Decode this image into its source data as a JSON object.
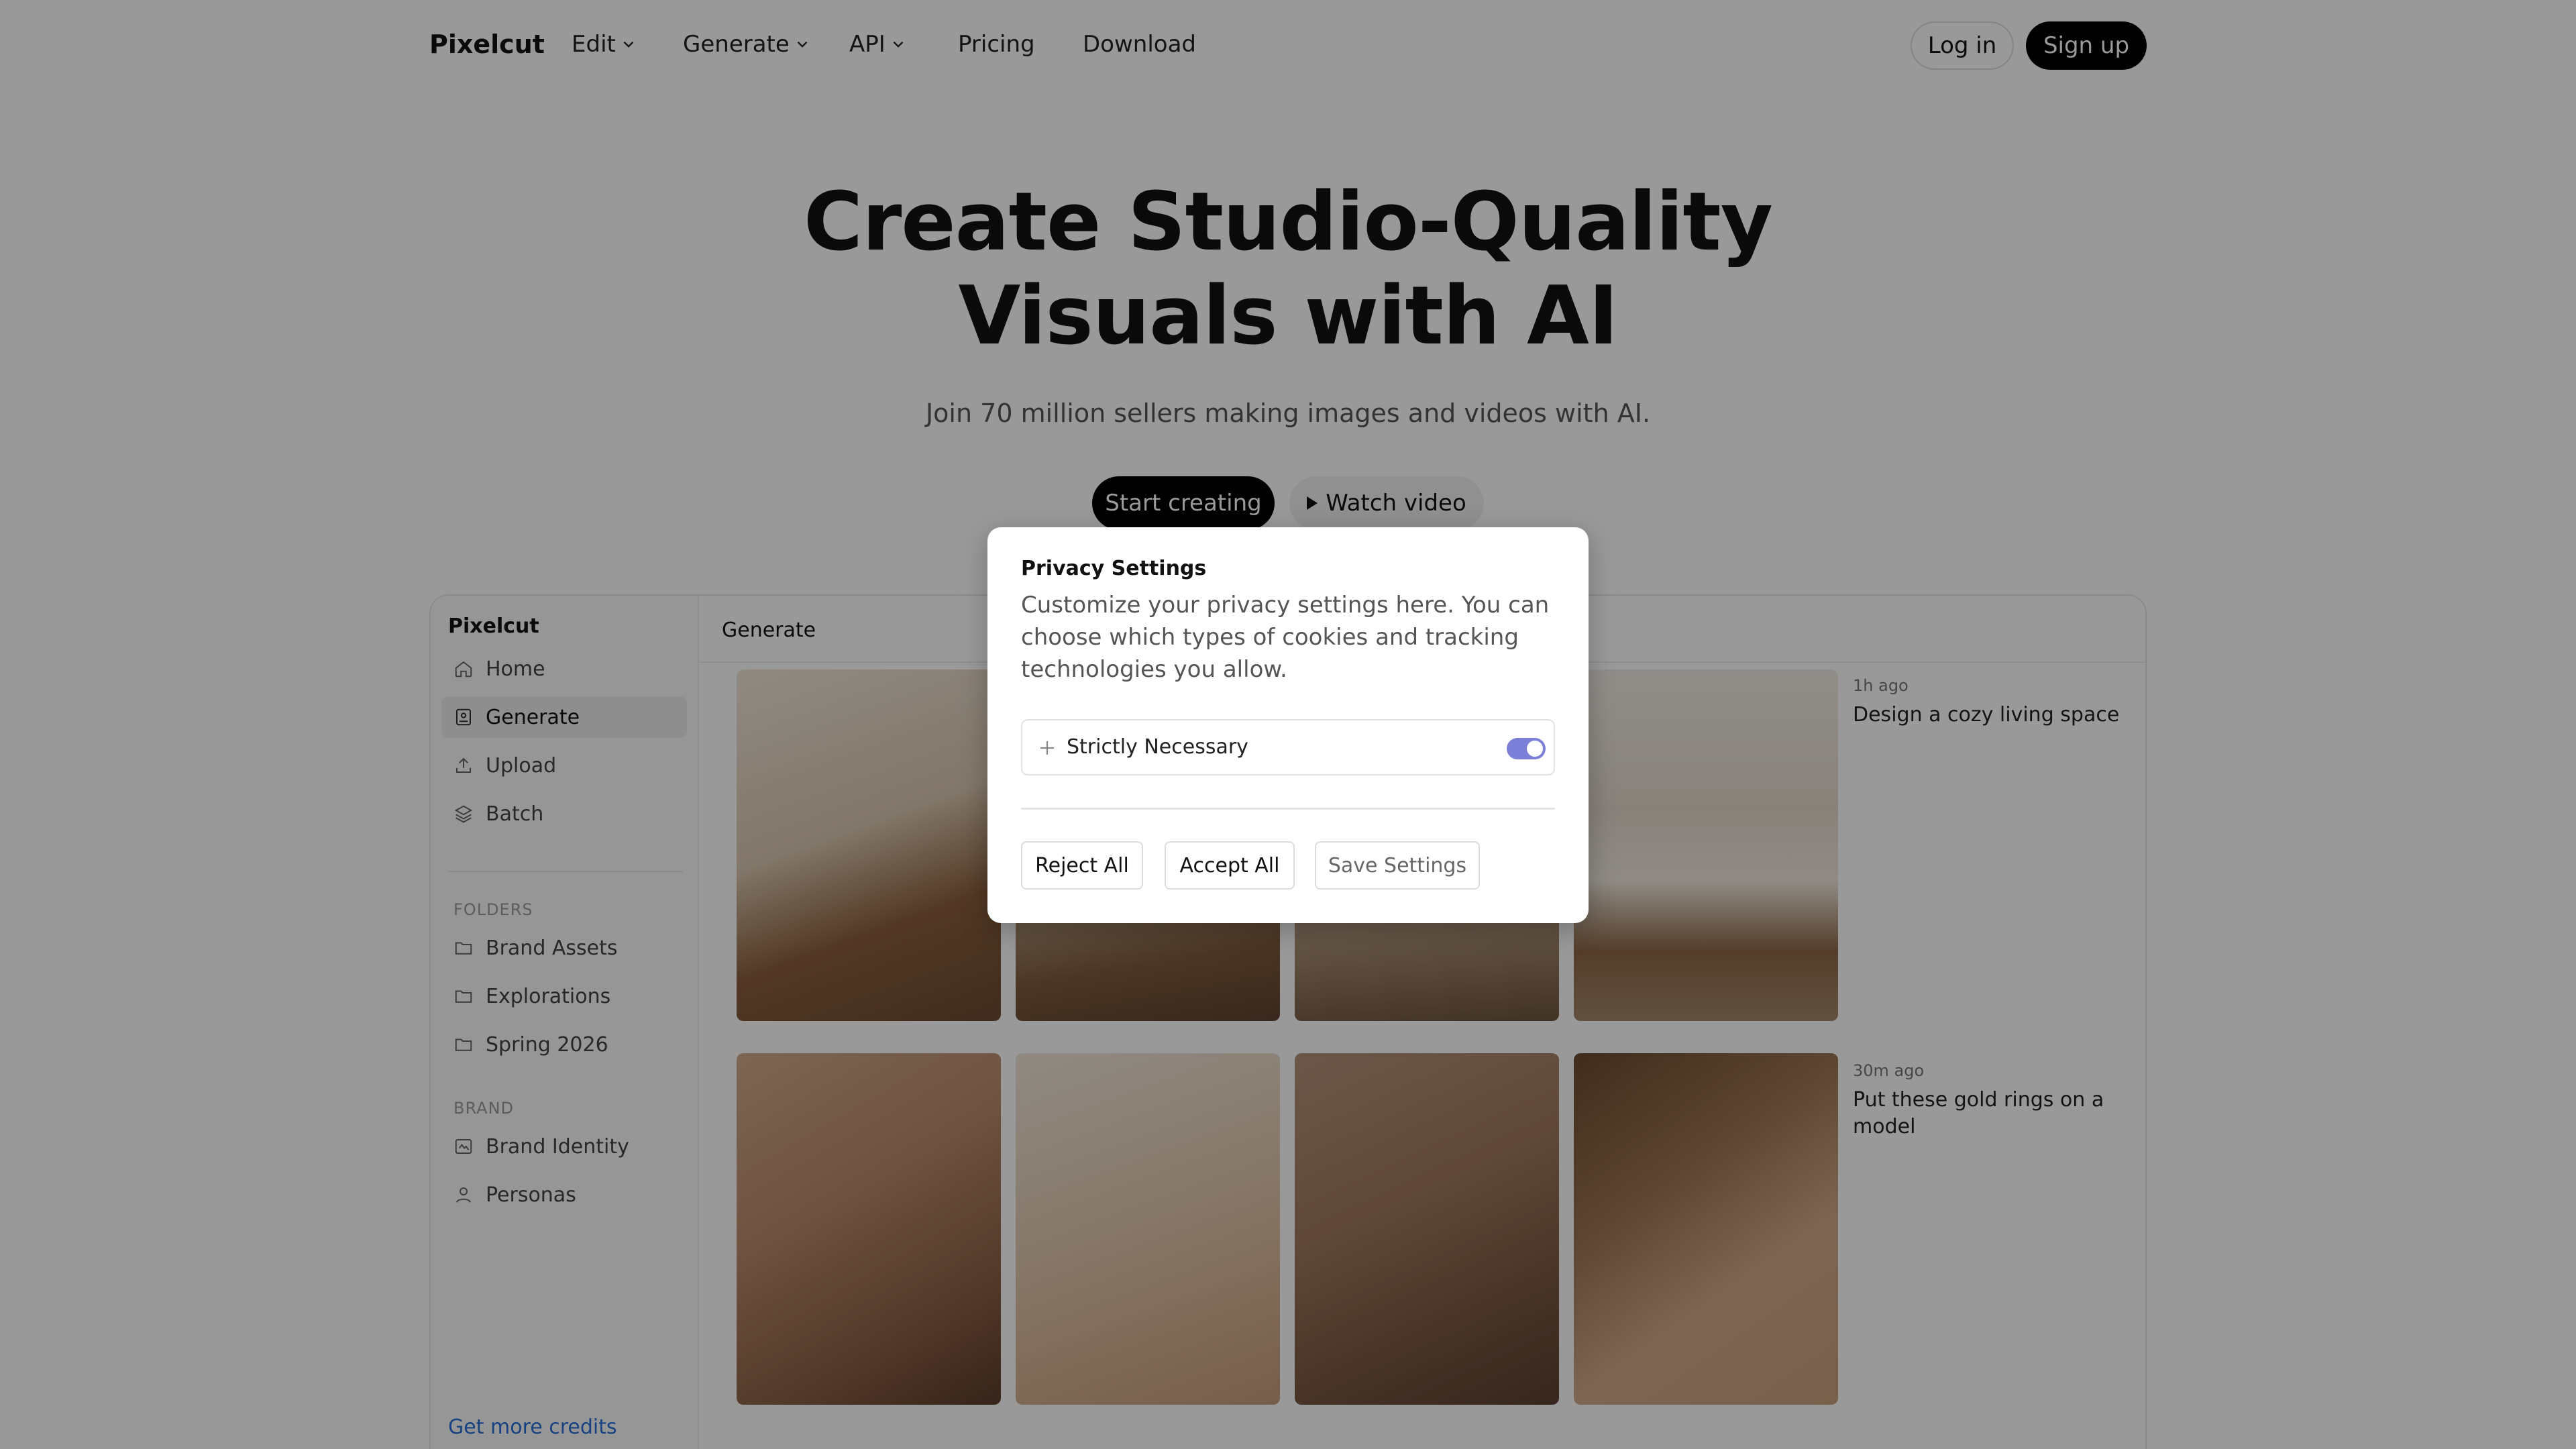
{
  "nav": {
    "logo": "Pixelcut",
    "items": [
      {
        "label": "Edit",
        "dropdown": true
      },
      {
        "label": "Generate",
        "dropdown": true
      },
      {
        "label": "API",
        "dropdown": true
      },
      {
        "label": "Pricing",
        "dropdown": false
      },
      {
        "label": "Download",
        "dropdown": false
      }
    ],
    "login": "Log in",
    "signup": "Sign up"
  },
  "hero": {
    "title_line1": "Create Studio-Quality",
    "title_line2": "Visuals with AI",
    "subtitle": "Join 70 million sellers making images and videos with AI.",
    "start_button": "Start creating",
    "watch_button": "Watch video"
  },
  "app": {
    "brand": "Pixelcut",
    "sidebar": {
      "items": [
        {
          "label": "Home",
          "icon": "home-icon",
          "active": false
        },
        {
          "label": "Generate",
          "icon": "generate-icon",
          "active": true
        },
        {
          "label": "Upload",
          "icon": "upload-icon",
          "active": false
        },
        {
          "label": "Batch",
          "icon": "layers-icon",
          "active": false
        }
      ],
      "folders_label": "FOLDERS",
      "folders": [
        {
          "label": "Brand Assets",
          "icon": "folder-icon"
        },
        {
          "label": "Explorations",
          "icon": "folder-icon"
        },
        {
          "label": "Spring 2026",
          "icon": "folder-icon"
        }
      ],
      "brand_label": "BRAND",
      "brand_items": [
        {
          "label": "Brand Identity",
          "icon": "brand-identity-icon"
        },
        {
          "label": "Personas",
          "icon": "person-icon"
        }
      ],
      "credits": "Get more credits"
    },
    "main_title": "Generate",
    "generations": [
      {
        "time": "1h ago",
        "prompt": "Design a cozy living space"
      },
      {
        "time": "30m ago",
        "prompt": "Put these gold rings on a model"
      }
    ]
  },
  "modal": {
    "title": "Privacy Settings",
    "description": "Customize your privacy settings here. You can choose which types of cookies and tracking technologies you allow.",
    "category": "Strictly Necessary",
    "category_enabled": true,
    "reject": "Reject All",
    "accept": "Accept All",
    "save": "Save Settings",
    "colors": {
      "toggle": "#7b7fd8"
    }
  }
}
